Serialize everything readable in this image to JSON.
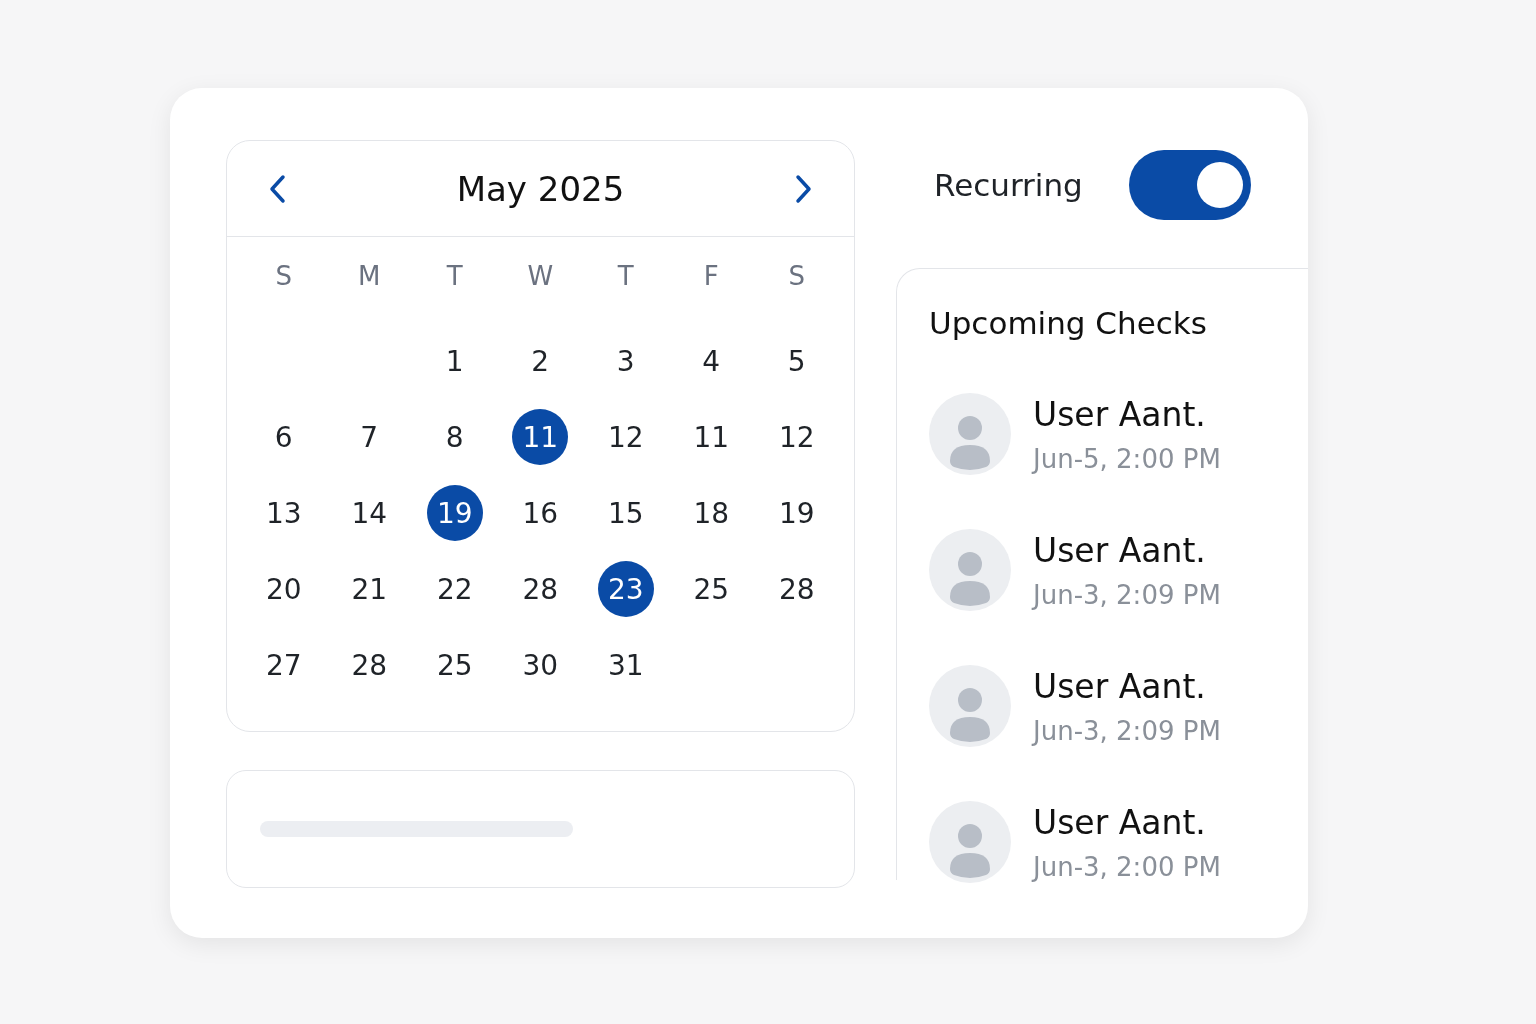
{
  "calendar": {
    "title": "May 2025",
    "weekdays": [
      "S",
      "M",
      "T",
      "W",
      "T",
      "F",
      "S"
    ],
    "weeks": [
      {
        "kind": "first",
        "days": [
          {
            "label": "1",
            "selected": false
          },
          {
            "label": "2",
            "selected": false
          },
          {
            "label": "3",
            "selected": false
          },
          {
            "label": "4",
            "selected": false
          },
          {
            "label": "5",
            "selected": false
          }
        ]
      },
      {
        "kind": "week",
        "days": [
          {
            "label": "6",
            "selected": false
          },
          {
            "label": "7",
            "selected": false
          },
          {
            "label": "8",
            "selected": false
          },
          {
            "label": "11",
            "selected": true
          },
          {
            "label": "12",
            "selected": false
          },
          {
            "label": "11",
            "selected": false
          },
          {
            "label": "12",
            "selected": false
          }
        ]
      },
      {
        "kind": "week",
        "days": [
          {
            "label": "13",
            "selected": false
          },
          {
            "label": "14",
            "selected": false
          },
          {
            "label": "19",
            "selected": true
          },
          {
            "label": "16",
            "selected": false
          },
          {
            "label": "15",
            "selected": false
          },
          {
            "label": "18",
            "selected": false
          },
          {
            "label": "19",
            "selected": false
          }
        ]
      },
      {
        "kind": "week",
        "days": [
          {
            "label": "20",
            "selected": false
          },
          {
            "label": "21",
            "selected": false
          },
          {
            "label": "22",
            "selected": false
          },
          {
            "label": "28",
            "selected": false
          },
          {
            "label": "23",
            "selected": true
          },
          {
            "label": "25",
            "selected": false
          },
          {
            "label": "28",
            "selected": false
          }
        ]
      },
      {
        "kind": "last",
        "days": [
          {
            "label": "27",
            "selected": false
          },
          {
            "label": "28",
            "selected": false
          },
          {
            "label": "25",
            "selected": false
          },
          {
            "label": "30",
            "selected": false
          },
          {
            "label": "31",
            "selected": false
          }
        ]
      }
    ]
  },
  "recurring": {
    "label": "Recurring",
    "on": true
  },
  "upcoming": {
    "title": "Upcoming Checks",
    "items": [
      {
        "name": "User Aant.",
        "time": "Jun-5, 2:00 PM"
      },
      {
        "name": "User Aant.",
        "time": "Jun-3, 2:09 PM"
      },
      {
        "name": "User Aant.",
        "time": "Jun-3, 2:09 PM"
      },
      {
        "name": "User Aant.",
        "time": "Jun-3, 2:00 PM"
      }
    ]
  }
}
